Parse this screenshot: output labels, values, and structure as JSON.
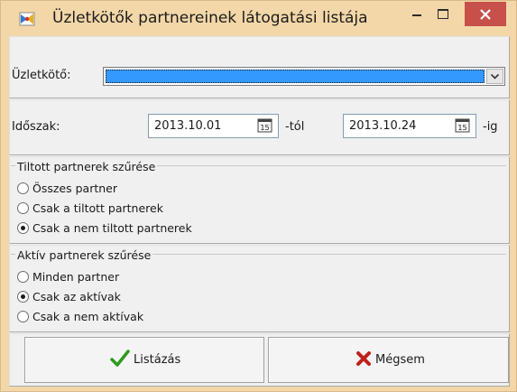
{
  "window": {
    "title": "Üzletkötők partnereinek látogatási listája",
    "colors": {
      "frame": "#f3d7a8",
      "close": "#c7504a",
      "selection": "#3399ff",
      "checkmark": "#2e9a1e",
      "cross": "#c0201a"
    }
  },
  "salesperson": {
    "label": "Üzletkötő:",
    "value": ""
  },
  "period": {
    "label": "Időszak:",
    "from_value": "2013.10.01",
    "from_suffix": "-tól",
    "to_value": "2013.10.24",
    "to_suffix": "-ig",
    "calendar_icon_text": "15"
  },
  "banned_filter": {
    "legend": "Tiltott partnerek szűrése",
    "options": [
      "Összes partner",
      "Csak a tiltott partnerek",
      "Csak a nem tiltott partnerek"
    ],
    "selected": "Csak a nem tiltott partnerek"
  },
  "active_filter": {
    "legend": "Aktív partnerek szűrése",
    "options": [
      "Minden partner",
      "Csak az aktívak",
      "Csak a nem aktívak"
    ],
    "selected": "Csak az aktívak"
  },
  "buttons": {
    "list_label": "Listázás",
    "cancel_label": "Mégsem"
  }
}
